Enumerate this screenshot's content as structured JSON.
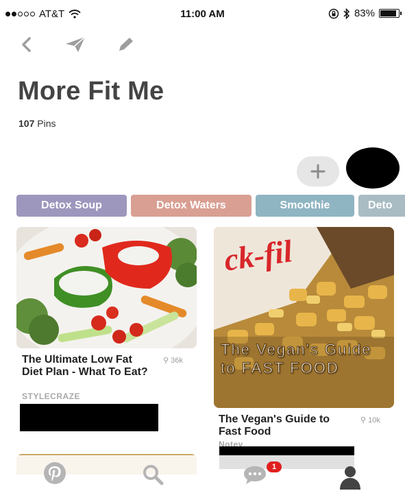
{
  "status_bar": {
    "carrier": "AT&T",
    "time": "11:00 AM",
    "battery": "83%",
    "battery_level": 0.83,
    "signal_bars_filled": 2,
    "signal_bars_total": 5
  },
  "toolbar": {
    "back_icon": "chevron-left-icon",
    "send_icon": "paper-plane-icon",
    "edit_icon": "pencil-icon"
  },
  "board": {
    "title": "More Fit Me",
    "pin_count": "107",
    "pin_label": "Pins"
  },
  "actions": {
    "add_icon": "plus-icon"
  },
  "sections": [
    {
      "label": "Detox Soup",
      "color": "#9d97bd"
    },
    {
      "label": "Detox Waters",
      "color": "#d99f93"
    },
    {
      "label": "Smoothie",
      "color": "#8fb4c2"
    },
    {
      "label": "Deto",
      "color": "#a9bcc4"
    }
  ],
  "pins": [
    {
      "title": "The Ultimate Low Fat Diet Plan - What To Eat?",
      "saves": "36k",
      "source": "STYLECRAZE"
    },
    {
      "title": "The Vegan's Guide to Fast Food",
      "saves": "10k",
      "source": "Notey",
      "image_overlay": "The Vegan's Guide to FAST FOOD",
      "image_sign": "ck-fil"
    }
  ],
  "bottom_nav": {
    "home_icon": "pinterest-logo-icon",
    "search_icon": "search-icon",
    "messages_icon": "chat-bubble-icon",
    "messages_badge": "1",
    "profile_icon": "person-icon"
  },
  "colors": {
    "title": "#444444",
    "badge": "#e02020",
    "icons": "#9e9e9e"
  }
}
